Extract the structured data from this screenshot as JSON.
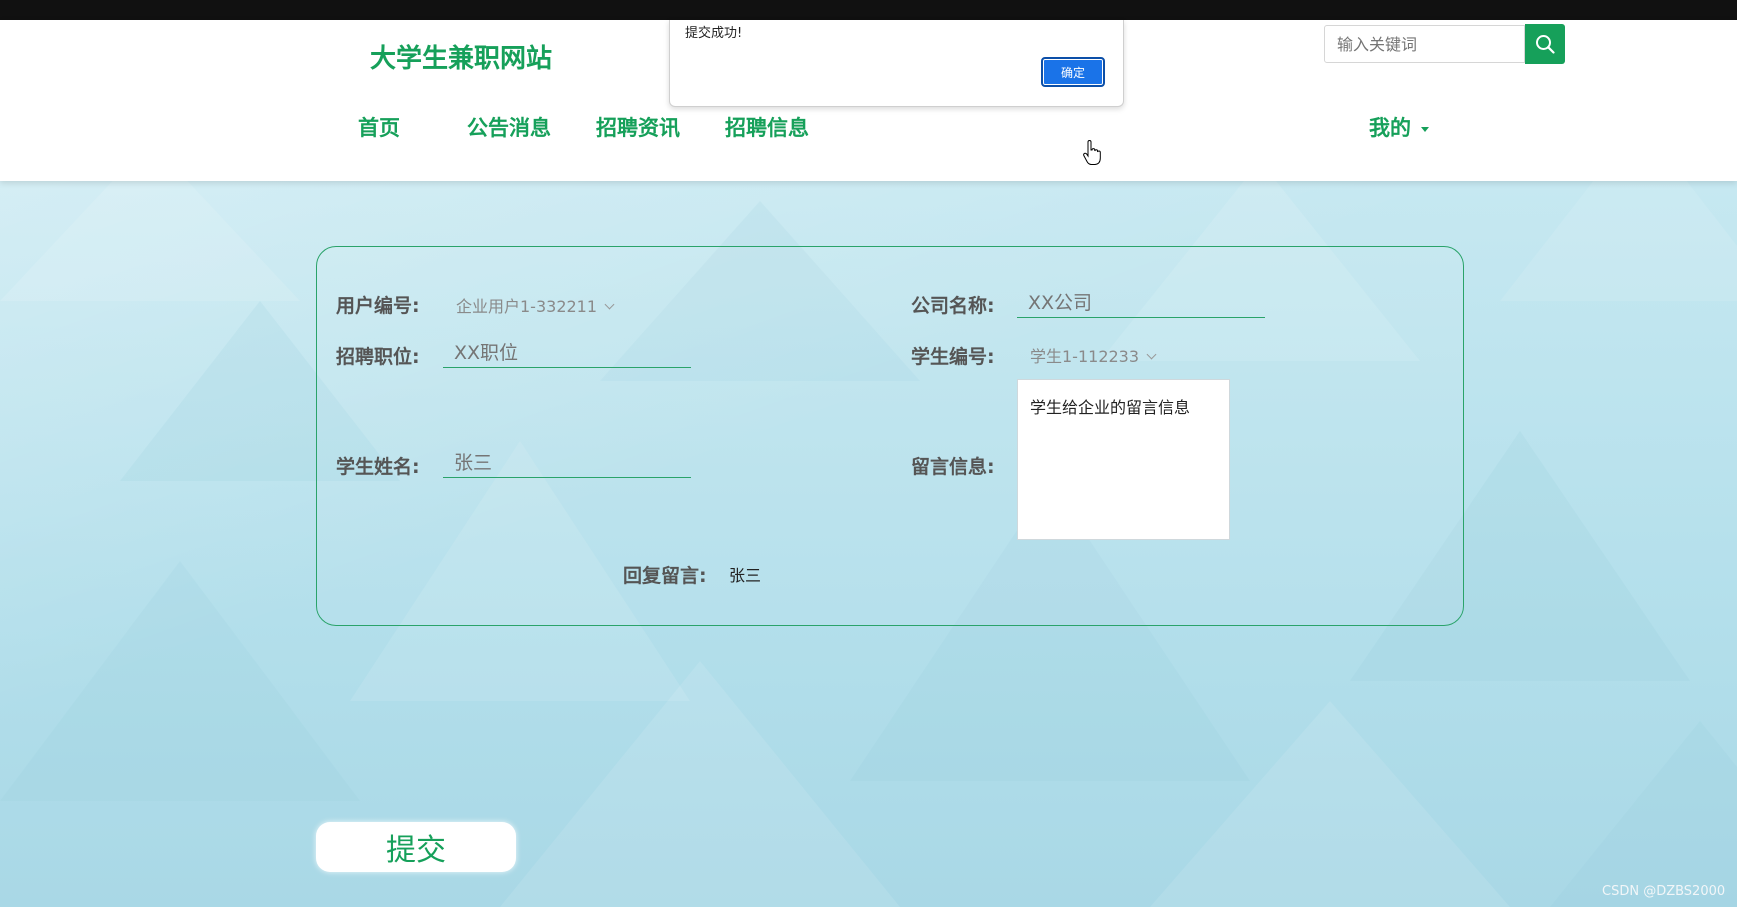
{
  "header": {
    "site_title": "大学生兼职网站",
    "search_placeholder": "输入关键词",
    "nav": [
      "首页",
      "公告消息",
      "招聘资讯",
      "招聘信息"
    ],
    "mine_label": "我的"
  },
  "alert": {
    "message": "提交成功!",
    "ok_label": "确定"
  },
  "form": {
    "user_id_label": "用户编号:",
    "user_id_value": "企业用户1-332211",
    "company_label": "公司名称:",
    "company_placeholder": "XX公司",
    "position_label": "招聘职位:",
    "position_placeholder": "XX职位",
    "student_id_label": "学生编号:",
    "student_id_value": "学生1-112233",
    "student_name_label": "学生姓名:",
    "student_name_placeholder": "张三",
    "message_label": "留言信息:",
    "message_value": "学生给企业的留言信息",
    "reply_label": "回复留言:",
    "reply_value": "张三"
  },
  "submit_label": "提交",
  "watermark": "CSDN @DZBS2000",
  "colors": {
    "brand": "#16a05a",
    "dialog_button": "#1a73e8"
  },
  "icons": {
    "search": "magnifier",
    "dropdown": "chevron-down",
    "cursor": "hand-pointer"
  }
}
